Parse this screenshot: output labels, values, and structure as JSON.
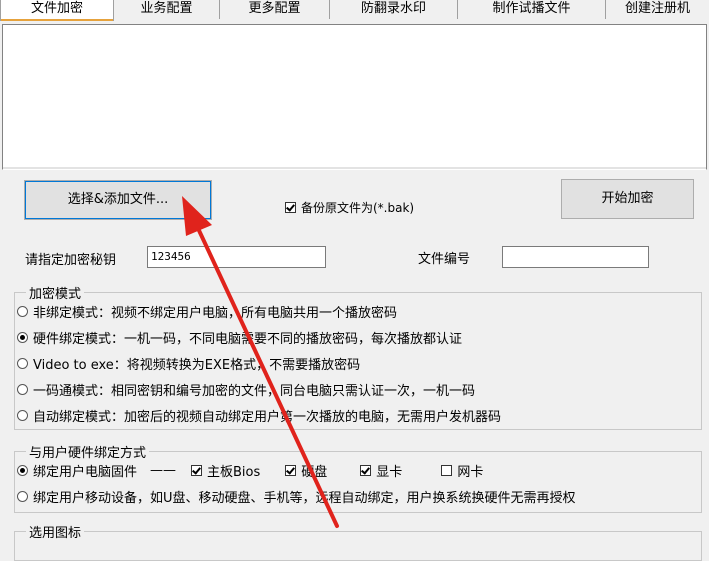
{
  "tabs": [
    "文件加密",
    "业务配置",
    "更多配置",
    "防翻录水印",
    "制作试播文件",
    "创建注册机"
  ],
  "select_files_button": "选择&添加文件...",
  "backup_checkbox": "备份原文件为(*.bak)",
  "start_button": "开始加密",
  "key_label": "请指定加密秘钥",
  "key_value": "123456",
  "file_number_label": "文件编号",
  "file_number_value": "",
  "encrypt_mode": {
    "legend": "加密模式",
    "options": [
      "非绑定模式：视频不绑定用户电脑，所有电脑共用一个播放密码",
      "硬件绑定模式：一机一码，不同电脑需要不同的播放密码，每次播放都认证",
      "Video to exe：将视频转换为EXE格式，不需要播放密码",
      "一码通模式：相同密钥和编号加密的文件，同台电脑只需认证一次，一机一码",
      "自动绑定模式：加密后的视频自动绑定用户第一次播放的电脑，无需用户发机器码"
    ],
    "selected": 1
  },
  "hardware_bind": {
    "legend": "与用户硬件绑定方式",
    "option1_label": "绑定用户电脑固件",
    "dash": "——",
    "components": [
      {
        "label": "主板Bios",
        "checked": true
      },
      {
        "label": "硬盘",
        "checked": true
      },
      {
        "label": "显卡",
        "checked": true
      },
      {
        "label": "网卡",
        "checked": false
      }
    ],
    "option2_label": "绑定用户移动设备，如U盘、移动硬盘、手机等，远程自动绑定，用户换系统换硬件无需再授权",
    "selected": 0
  },
  "icon_group": {
    "legend": "选用图标"
  },
  "colors": {
    "annotation_arrow": "#e0231c",
    "active_tab_accent": "#e6a23c"
  }
}
